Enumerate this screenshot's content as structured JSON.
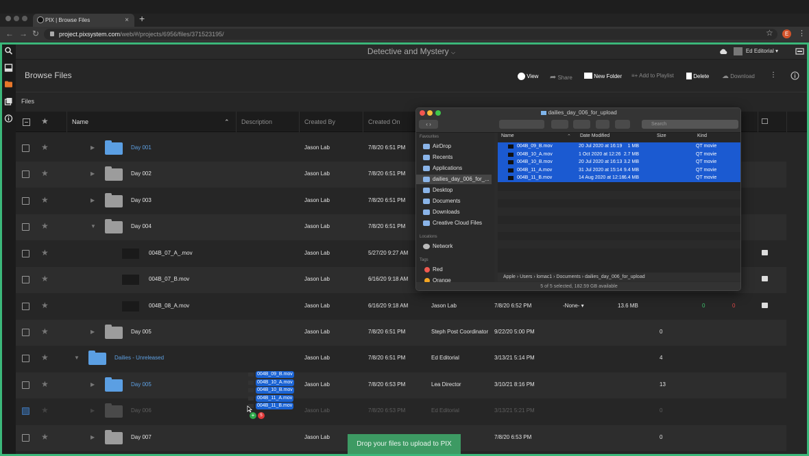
{
  "browser": {
    "tab_title": "PIX | Browse Files",
    "new_tab": "+",
    "url_host": "project.pixsystem.com",
    "url_path": "/web/#/projects/6956/files/371523195/",
    "profile_initial": "E"
  },
  "app": {
    "title": "Detective and Mystery",
    "user_name": "Ed Editorial",
    "page_title": "Browse Files",
    "section_label": "Files"
  },
  "toolbar": {
    "view": "View",
    "share": "Share",
    "new_folder": "New Folder",
    "add_to_playlist": "Add to Playlist",
    "delete": "Delete",
    "download": "Download"
  },
  "table": {
    "headers": {
      "name": "Name",
      "description": "Description",
      "created_by": "Created By",
      "created_on": "Created On"
    },
    "rows": [
      {
        "name": "Day 001",
        "kind": "folder-blue",
        "created_by": "Jason Lab",
        "created_on": "7/8/20 6:51 PM"
      },
      {
        "name": "Day 002",
        "kind": "folder",
        "created_by": "Jason Lab",
        "created_on": "7/8/20 6:51 PM"
      },
      {
        "name": "Day 003",
        "kind": "folder",
        "created_by": "Jason Lab",
        "created_on": "7/8/20 6:51 PM"
      },
      {
        "name": "Day 004",
        "kind": "folder-open",
        "created_by": "Jason Lab",
        "created_on": "7/8/20 6:51 PM"
      },
      {
        "name": "004B_07_A_.mov",
        "kind": "file",
        "created_by": "Jason Lab",
        "created_on": "5/27/20 9:27 AM"
      },
      {
        "name": "004B_07_B.mov",
        "kind": "file",
        "created_by": "Jason Lab",
        "created_on": "6/16/20 9:18 AM"
      },
      {
        "name": "004B_08_A.mov",
        "kind": "file",
        "created_by": "Jason Lab",
        "created_on": "6/16/20 9:18 AM",
        "modified_by": "Jason Lab",
        "modified_on": "7/8/20 6:52 PM",
        "status": "-None-",
        "size": "13.6 MB",
        "count_a": "0",
        "count_b": "0"
      },
      {
        "name": "Day 005",
        "kind": "folder",
        "created_by": "Jason Lab",
        "created_on": "7/8/20 6:51 PM",
        "modified_by": "Steph Post Coordinator",
        "modified_on": "9/22/20 5:00 PM",
        "items": "0"
      },
      {
        "name": "Dailies - Unreleased",
        "kind": "folder-blue-root",
        "created_by": "Jason Lab",
        "created_on": "7/8/20 6:51 PM",
        "modified_by": "Ed Editorial",
        "modified_on": "3/13/21 5:14 PM",
        "items": "4"
      },
      {
        "name": "Day 005",
        "kind": "folder-blue",
        "created_by": "Jason Lab",
        "created_on": "7/8/20 6:53 PM",
        "modified_by": "Lea Director",
        "modified_on": "3/10/21 8:16 PM",
        "items": "13"
      },
      {
        "name": "Day 006",
        "kind": "folder-ghost",
        "created_by": "Jason Lab",
        "created_on": "7/8/20 6:53 PM",
        "modified_by": "Ed Editorial",
        "modified_on": "3/13/21 5:21 PM",
        "items": "0"
      },
      {
        "name": "Day 007",
        "kind": "folder",
        "created_by": "Jason Lab",
        "created_on": "",
        "modified_by": "",
        "modified_on": "7/8/20 6:53 PM",
        "items": "0"
      }
    ]
  },
  "finder": {
    "title": "dailies_day_006_for_upload",
    "search_placeholder": "Search",
    "favourites_label": "Favourites",
    "locations_label": "Locations",
    "tags_label": "Tags",
    "sidebar": [
      "AirDrop",
      "Recents",
      "Applications",
      "dailies_day_006_for_...",
      "Desktop",
      "Documents",
      "Downloads",
      "Creative Cloud Files"
    ],
    "locations": [
      "Network"
    ],
    "tags": [
      "Red",
      "Orange"
    ],
    "columns": {
      "name": "Name",
      "date": "Date Modified",
      "size": "Size",
      "kind": "Kind"
    },
    "files": [
      {
        "name": "004B_09_B.mov",
        "date": "20 Jul 2020 at 16:19",
        "size": "1 MB",
        "kind": "QT movie"
      },
      {
        "name": "004B_10_A.mov",
        "date": "1 Oct 2020 at 12:26",
        "size": "2.7 MB",
        "kind": "QT movie"
      },
      {
        "name": "004B_10_B.mov",
        "date": "20 Jul 2020 at 16:13",
        "size": "3.2 MB",
        "kind": "QT movie"
      },
      {
        "name": "004B_11_A.mov",
        "date": "31 Jul 2020 at 15:14",
        "size": "9.4 MB",
        "kind": "QT movie"
      },
      {
        "name": "004B_11_B.mov",
        "date": "14 Aug 2020 at 12:16",
        "size": "6.4 MB",
        "kind": "QT movie"
      }
    ],
    "path": "Apple  ›  Users  ›  lomac1  ›  Documents  ›  dailies_day_006_for_upload",
    "status": "5 of 5 selected, 182.59 GB available"
  },
  "drag": {
    "items": [
      "004B_09_B.mov",
      "004B_10_A.mov",
      "004B_10_B.mov",
      "004B_11_A.mov",
      "004B_11_B.mov"
    ],
    "plus": "+",
    "count": "5"
  },
  "toast": "Drop your files to upload to PIX",
  "colors": {
    "accent_green": "#3bb77a",
    "folder_blue": "#5b9fe3",
    "selection_blue": "#1b5ad1"
  }
}
